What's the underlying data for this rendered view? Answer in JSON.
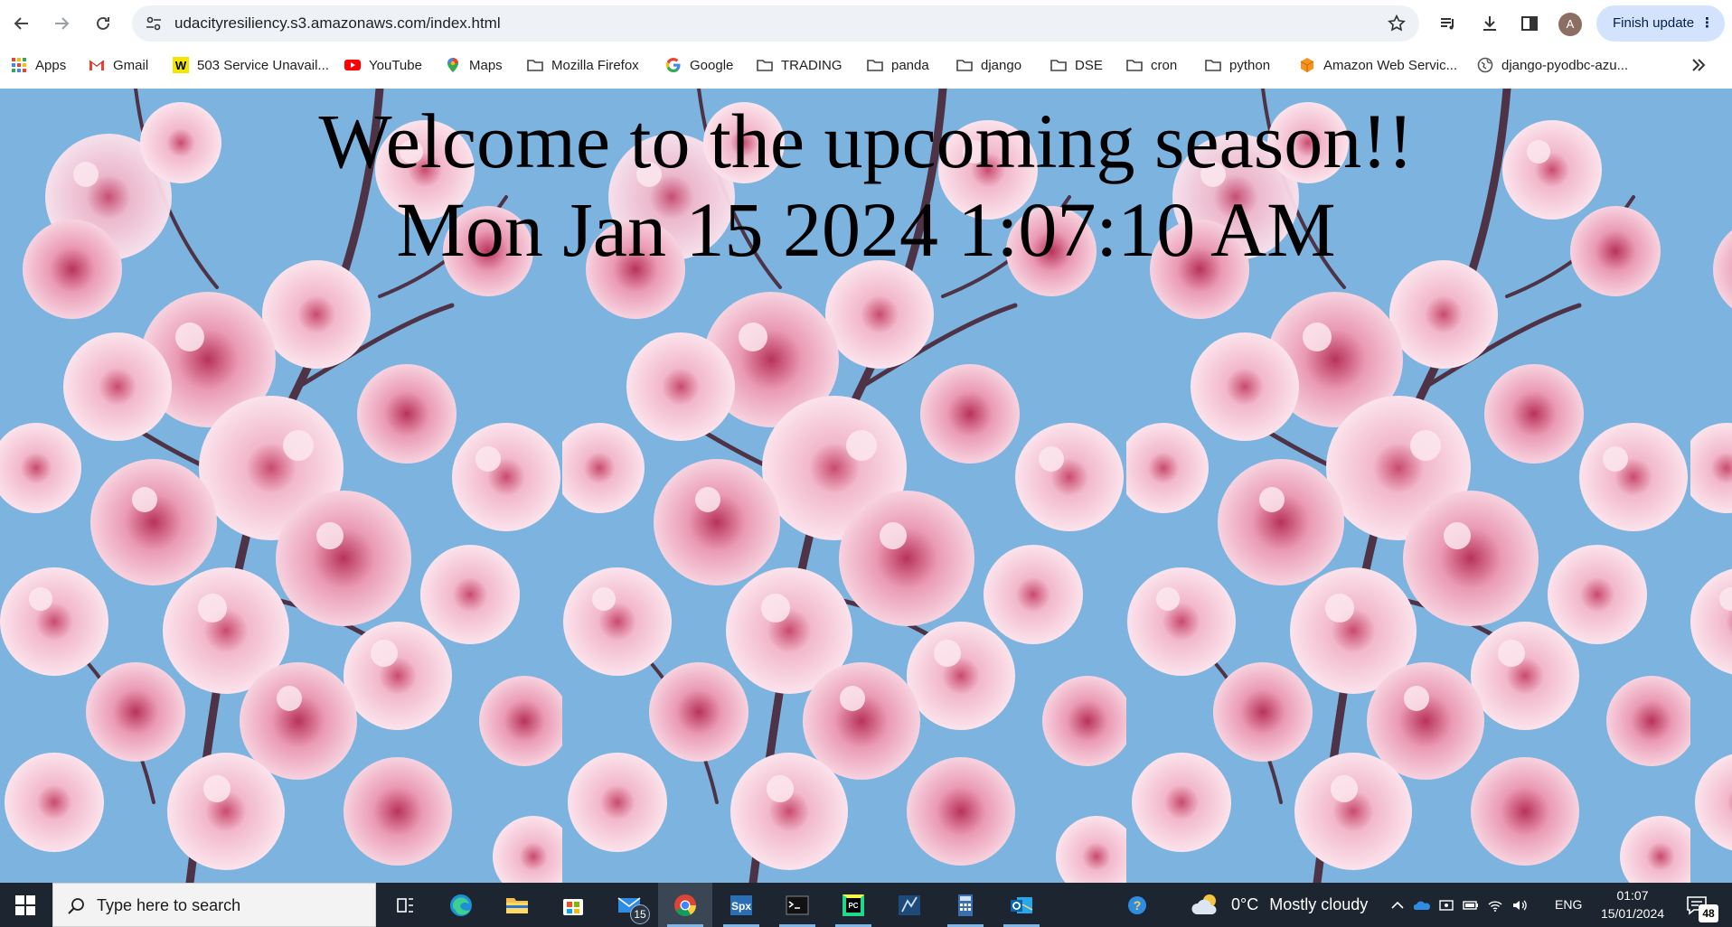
{
  "browser": {
    "url": "udacityresiliency.s3.amazonaws.com/index.html",
    "avatar_letter": "A",
    "finish_update_label": "Finish update"
  },
  "bookmarks": [
    {
      "label": "Apps",
      "icon": "apps-grid-icon"
    },
    {
      "label": "Gmail",
      "icon": "gmail-icon"
    },
    {
      "label": "503 Service Unavail...",
      "icon": "w-site-icon"
    },
    {
      "label": "YouTube",
      "icon": "youtube-icon"
    },
    {
      "label": "Maps",
      "icon": "maps-pin-icon"
    },
    {
      "label": "Mozilla Firefox",
      "icon": "folder-icon"
    },
    {
      "label": "Google",
      "icon": "google-icon"
    },
    {
      "label": "TRADING",
      "icon": "folder-icon"
    },
    {
      "label": "panda",
      "icon": "folder-icon"
    },
    {
      "label": "django",
      "icon": "folder-icon"
    },
    {
      "label": "DSE",
      "icon": "folder-icon"
    },
    {
      "label": "cron",
      "icon": "folder-icon"
    },
    {
      "label": "python",
      "icon": "folder-icon"
    },
    {
      "label": "Amazon Web Servic...",
      "icon": "aws-cube-icon"
    },
    {
      "label": "django-pyodbc-azu...",
      "icon": "globe-icon"
    }
  ],
  "page": {
    "heading": "Welcome to the upcoming season!!",
    "datetime": "Mon Jan 15 2024 1:07:10 AM",
    "background": "cherry blossom photo tiled",
    "colors": {
      "sky": "#7eb4e0",
      "blossom": "#f4c6d6",
      "blossom_dark": "#d9708e",
      "branch": "#5a3a4a"
    }
  },
  "taskbar": {
    "search_placeholder": "Type here to search",
    "mail_badge": "15",
    "weather": {
      "temp": "0°C",
      "condition": "Mostly cloudy"
    },
    "language": "ENG",
    "time": "01:07",
    "date": "15/01/2024",
    "notification_count": "48"
  }
}
